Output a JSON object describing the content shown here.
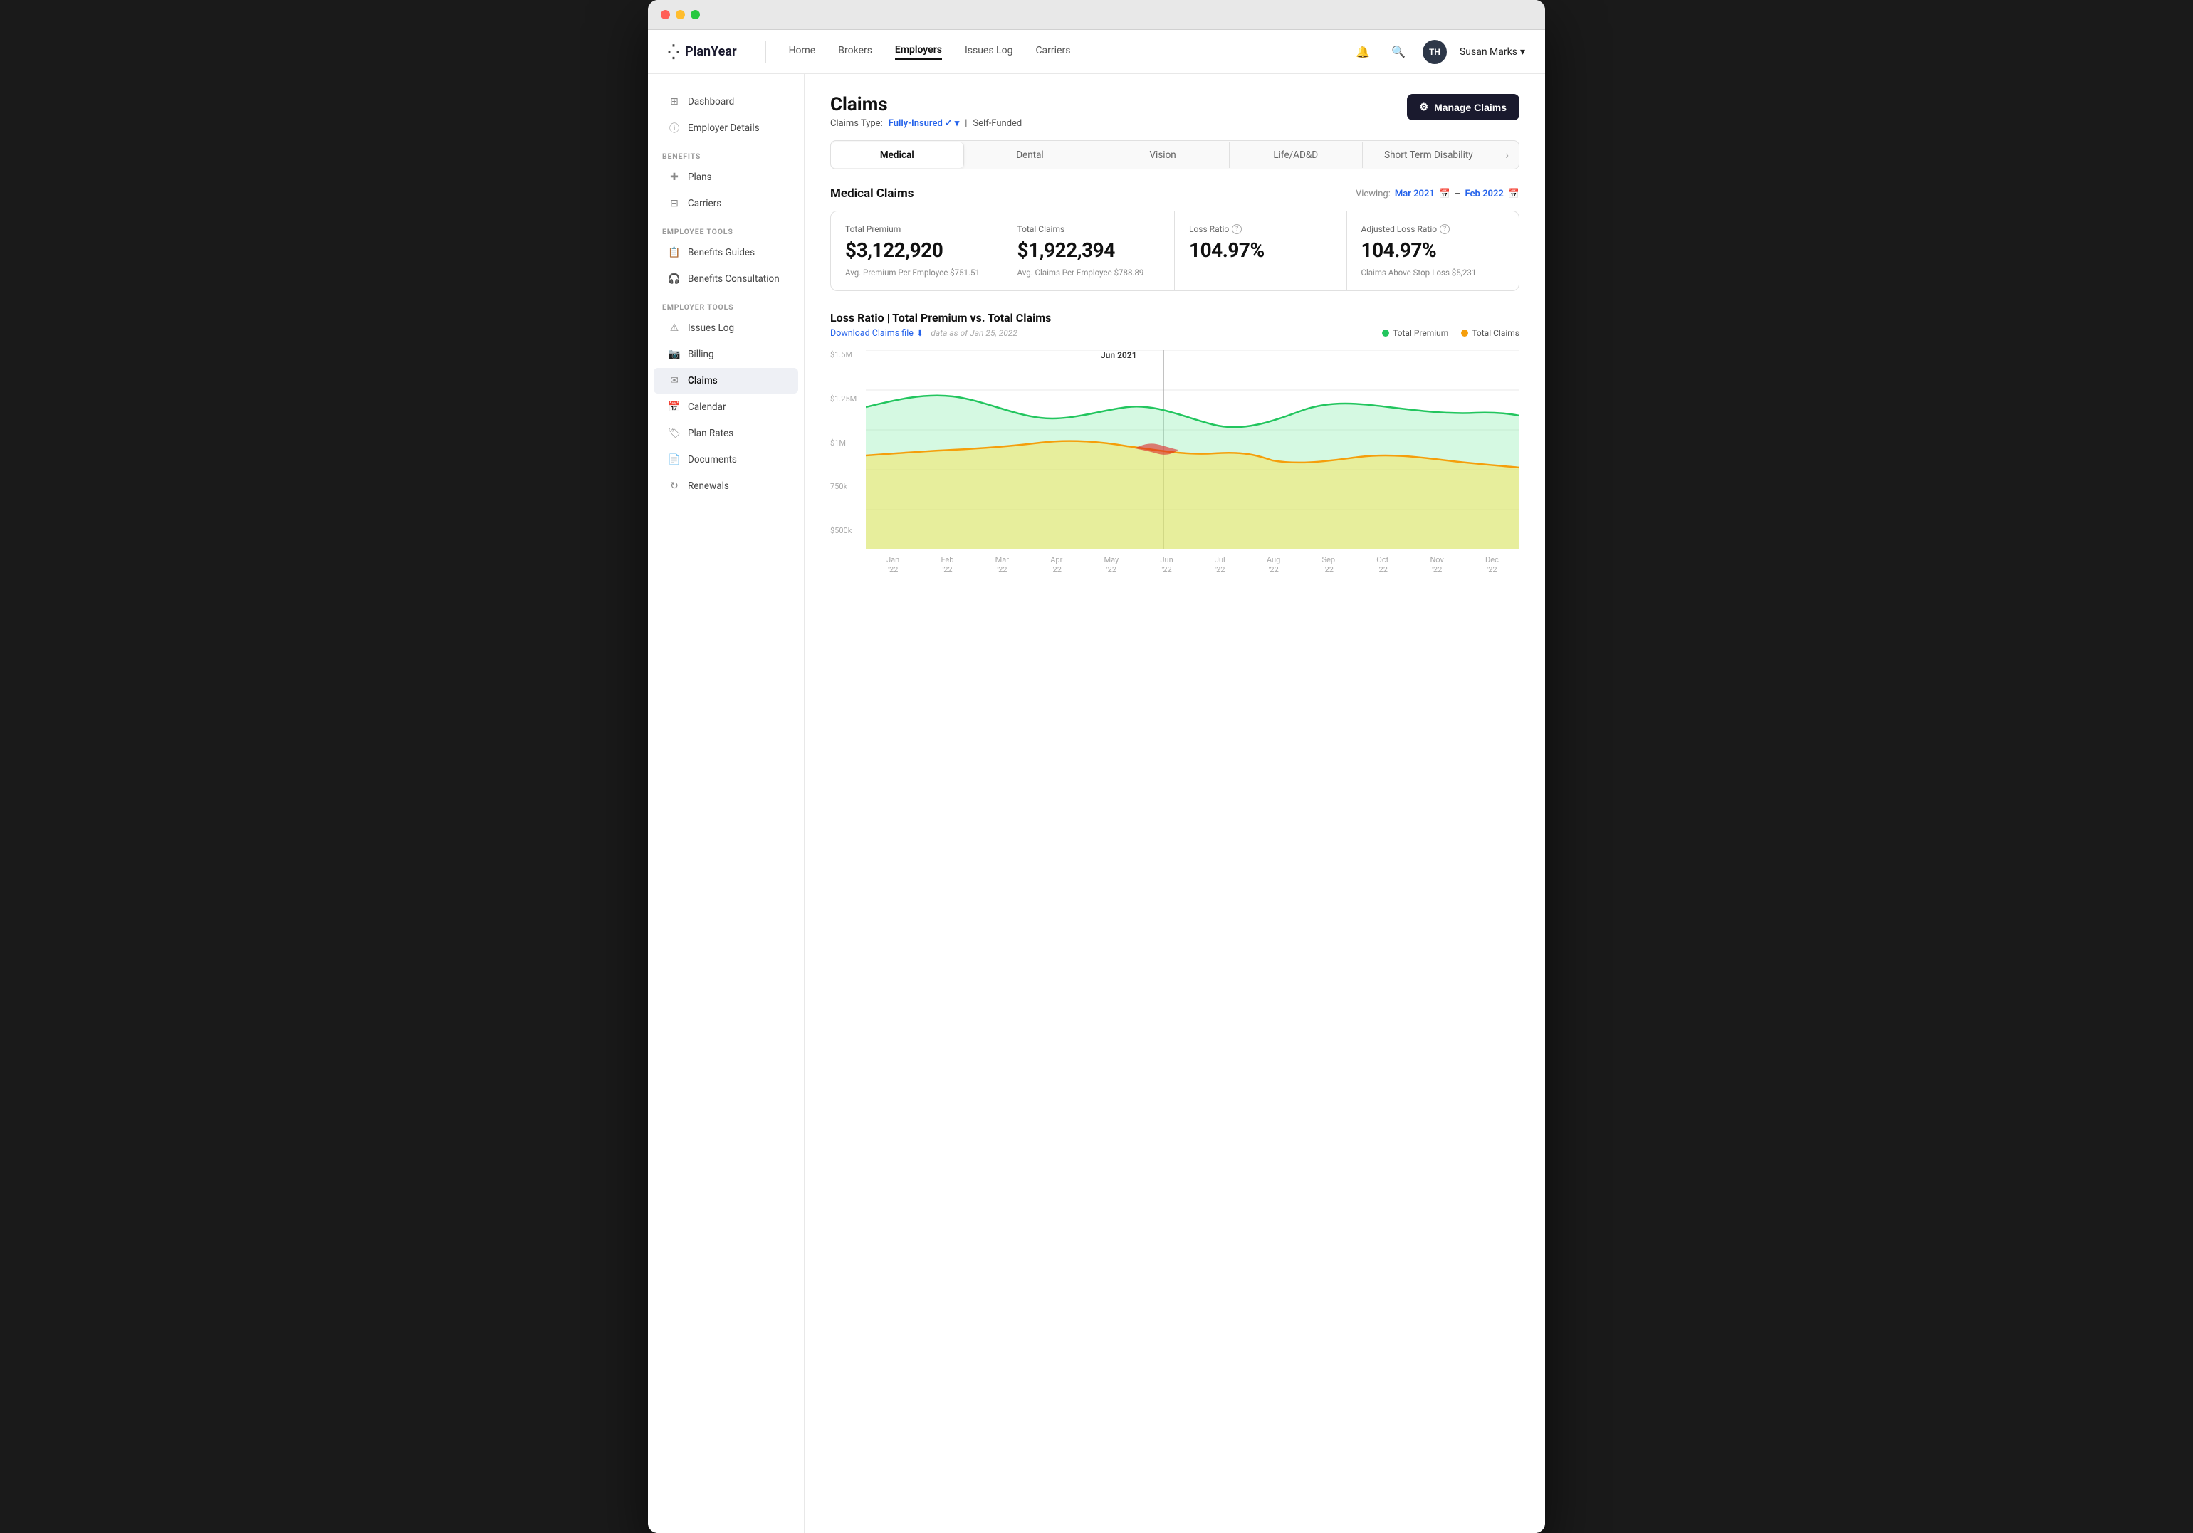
{
  "window": {
    "title": "PlanYear - Claims"
  },
  "topnav": {
    "logo": "PlanYear",
    "links": [
      {
        "id": "home",
        "label": "Home",
        "active": false
      },
      {
        "id": "brokers",
        "label": "Brokers",
        "active": false
      },
      {
        "id": "employers",
        "label": "Employers",
        "active": true
      },
      {
        "id": "issues-log",
        "label": "Issues Log",
        "active": false
      },
      {
        "id": "carriers",
        "label": "Carriers",
        "active": false
      }
    ],
    "user": {
      "initials": "TH",
      "name": "Susan Marks"
    }
  },
  "sidebar": {
    "top_items": [
      {
        "id": "dashboard",
        "label": "Dashboard",
        "icon": "grid"
      },
      {
        "id": "employer-details",
        "label": "Employer Details",
        "icon": "info"
      }
    ],
    "sections": [
      {
        "label": "BENEFITS",
        "items": [
          {
            "id": "plans",
            "label": "Plans",
            "icon": "plus-circle"
          },
          {
            "id": "carriers",
            "label": "Carriers",
            "icon": "grid-small"
          }
        ]
      },
      {
        "label": "EMPLOYEE TOOLS",
        "items": [
          {
            "id": "benefits-guides",
            "label": "Benefits Guides",
            "icon": "book"
          },
          {
            "id": "benefits-consultation",
            "label": "Benefits Consultation",
            "icon": "headphones"
          }
        ]
      },
      {
        "label": "EMPLOYER TOOLS",
        "items": [
          {
            "id": "issues-log",
            "label": "Issues Log",
            "icon": "alert"
          },
          {
            "id": "billing",
            "label": "Billing",
            "icon": "camera"
          },
          {
            "id": "claims",
            "label": "Claims",
            "icon": "mail",
            "active": true
          },
          {
            "id": "calendar",
            "label": "Calendar",
            "icon": "calendar"
          },
          {
            "id": "plan-rates",
            "label": "Plan Rates",
            "icon": "tag"
          },
          {
            "id": "documents",
            "label": "Documents",
            "icon": "file"
          },
          {
            "id": "renewals",
            "label": "Renewals",
            "icon": "refresh"
          }
        ]
      }
    ]
  },
  "content": {
    "page_title": "Claims",
    "claims_type_label": "Claims Type:",
    "claims_type_selected": "Fully-Insured",
    "claims_type_separator": "|",
    "claims_type_other": "Self-Funded",
    "manage_claims_btn": "Manage Claims",
    "tabs": [
      {
        "id": "medical",
        "label": "Medical",
        "active": true
      },
      {
        "id": "dental",
        "label": "Dental",
        "active": false
      },
      {
        "id": "vision",
        "label": "Vision",
        "active": false
      },
      {
        "id": "life-add",
        "label": "Life/AD&D",
        "active": false
      },
      {
        "id": "short-term-disability",
        "label": "Short Term Disability",
        "active": false
      }
    ],
    "section_title": "Medical Claims",
    "viewing_label": "Viewing:",
    "viewing_start": "Mar 2021",
    "viewing_end": "Feb 2022",
    "stats": [
      {
        "id": "total-premium",
        "label": "Total Premium",
        "has_info": false,
        "value": "$3,122,920",
        "sub": "Avg. Premium Per Employee $751.51"
      },
      {
        "id": "total-claims",
        "label": "Total Claims",
        "has_info": false,
        "value": "$1,922,394",
        "sub": "Avg. Claims Per Employee $788.89"
      },
      {
        "id": "loss-ratio",
        "label": "Loss Ratio",
        "has_info": true,
        "value": "104.97%",
        "sub": ""
      },
      {
        "id": "adjusted-loss-ratio",
        "label": "Adjusted Loss Ratio",
        "has_info": true,
        "value": "104.97%",
        "sub": "Claims Above Stop-Loss $5,231"
      }
    ],
    "chart": {
      "title": "Loss Ratio | Total Premium vs. Total Claims",
      "download_label": "Download Claims file",
      "data_as_of": "data as of Jan 25, 2022",
      "tooltip_label": "Jun 2021",
      "legend": [
        {
          "id": "total-premium",
          "label": "Total Premium",
          "color": "#22c55e"
        },
        {
          "id": "total-claims",
          "label": "Total Claims",
          "color": "#f59e0b"
        }
      ],
      "y_labels": [
        "$1.5M",
        "$1.25M",
        "$1M",
        "750k",
        "$500k"
      ],
      "x_labels": [
        {
          "line1": "Jan",
          "line2": "'22"
        },
        {
          "line1": "Feb",
          "line2": "'22"
        },
        {
          "line1": "Mar",
          "line2": "'22"
        },
        {
          "line1": "Apr",
          "line2": "'22"
        },
        {
          "line1": "May",
          "line2": "'22"
        },
        {
          "line1": "Jun",
          "line2": "'22"
        },
        {
          "line1": "Jul",
          "line2": "'22"
        },
        {
          "line1": "Aug",
          "line2": "'22"
        },
        {
          "line1": "Sep",
          "line2": "'22"
        },
        {
          "line1": "Oct",
          "line2": "'22"
        },
        {
          "line1": "Nov",
          "line2": "'22"
        },
        {
          "line1": "Dec",
          "line2": "'22"
        }
      ]
    }
  }
}
